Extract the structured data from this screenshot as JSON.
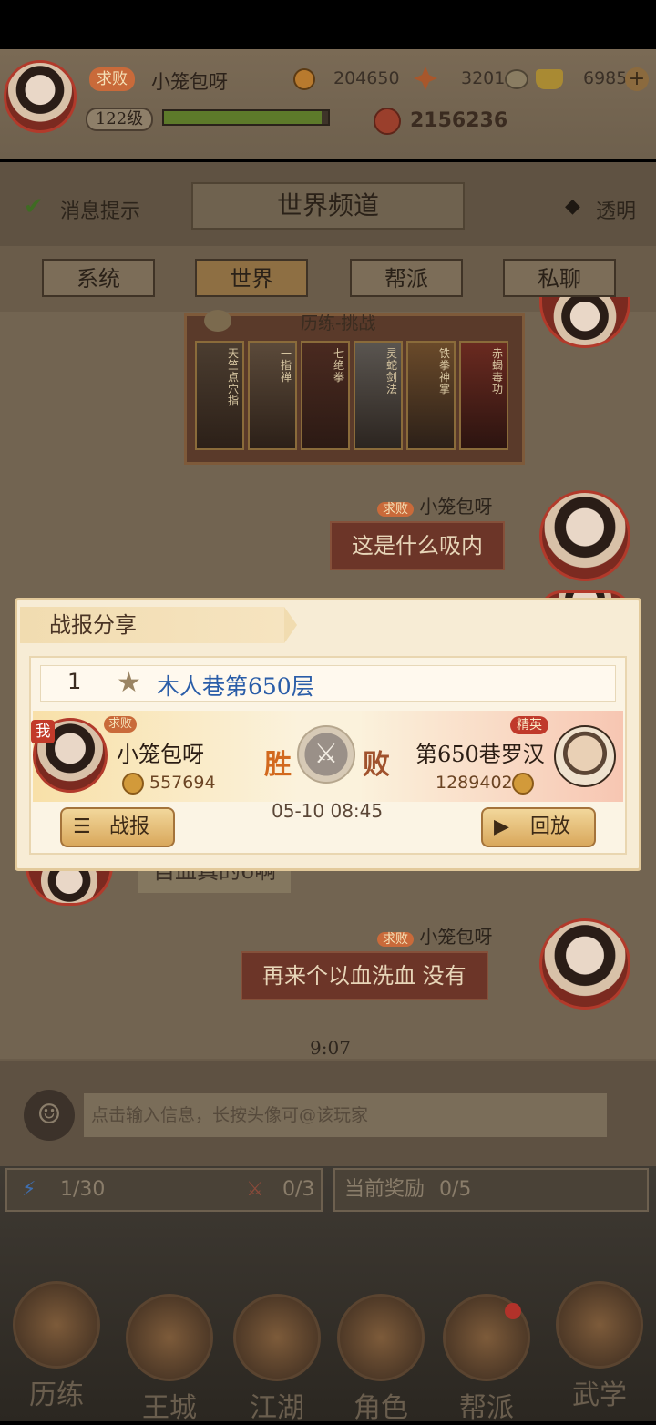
{
  "player": {
    "title_badge": "求败",
    "name": "小笼包呀",
    "level": "122级",
    "coins": "204650",
    "ingots": "3201",
    "gold": "6985",
    "power": "2156236"
  },
  "chat": {
    "channel_title": "世界频道",
    "notify_label": "消息提示",
    "transparent_label": "透明",
    "tabs": [
      "系统",
      "世界",
      "帮派",
      "私聊"
    ],
    "challenge_card_title": "历练-挑战",
    "card_labels": [
      "天竺点穴指",
      "一指禅",
      "七绝拳",
      "灵蛇剑法",
      "铁拳神掌",
      "赤蝎毒功"
    ],
    "messages": [
      {
        "badge": "求败",
        "sender": "小笼包呀",
        "text": "这是什么吸内"
      },
      {
        "text": "自血真的6啊"
      },
      {
        "badge": "求败",
        "sender": "小笼包呀",
        "text": "再来个以血洗血 没有"
      }
    ],
    "timestamp": "9:07",
    "input_placeholder": "点击输入信息，长按头像可@该玩家"
  },
  "battle_report": {
    "title": "战报分享",
    "index": "1",
    "stage": "木人巷第650层",
    "left_badge": "求败",
    "left_me": "我",
    "left_name": "小笼包呀",
    "left_score": "557694",
    "win_label": "胜",
    "lose_label": "败",
    "time": "05-10 08:45",
    "right_badge": "精英",
    "right_name": "第650巷罗汉",
    "right_score": "1289402",
    "report_button": "战报",
    "replay_button": "回放"
  },
  "quests": {
    "energy": "1/30",
    "attempts": "0/3",
    "reward_label": "当前奖励",
    "reward_count": "0/5"
  },
  "nav": [
    "历练",
    "王城",
    "江湖",
    "角色",
    "帮派",
    "武学"
  ],
  "colors": {
    "accent_red": "#b2322a",
    "gold": "#d9a85c",
    "link_blue": "#2a5da8"
  }
}
